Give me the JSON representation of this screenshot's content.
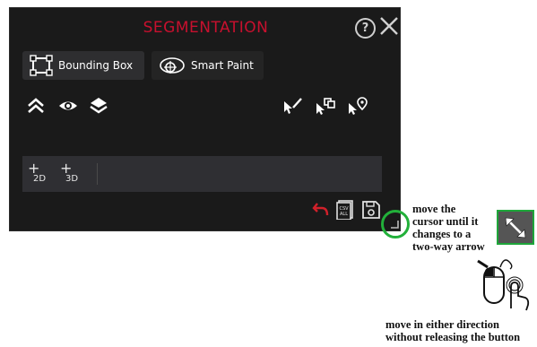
{
  "panel": {
    "title": "SEGMENTATION",
    "help_icon": "help-circle-icon",
    "close_icon": "close-icon"
  },
  "tabs": [
    {
      "label": "Bounding Box",
      "icon": "bounding-box-icon",
      "active": true
    },
    {
      "label": "Smart Paint",
      "icon": "smart-paint-icon",
      "active": false
    }
  ],
  "toolbar_left": [
    "collapse-icon",
    "eye-icon",
    "layers-icon"
  ],
  "toolbar_right": [
    "pen-cursor-icon",
    "copy-cursor-icon",
    "pin-cursor-icon"
  ],
  "dimension_buttons": [
    {
      "plus": "+",
      "label": "2D"
    },
    {
      "plus": "+",
      "label": "3D"
    }
  ],
  "bottom_icons": [
    "undo-icon",
    "csv-all-icon",
    "save-icon"
  ],
  "colors": {
    "panel_bg": "#1a1a1a",
    "title": "#c8102e",
    "highlight_green": "#22b03a"
  },
  "annotations": {
    "resize_instruction": [
      "move the",
      "cursor until it",
      "changes to a",
      "two-way arrow"
    ],
    "drag_instruction": [
      "move in either direction",
      "without releasing the button"
    ]
  }
}
